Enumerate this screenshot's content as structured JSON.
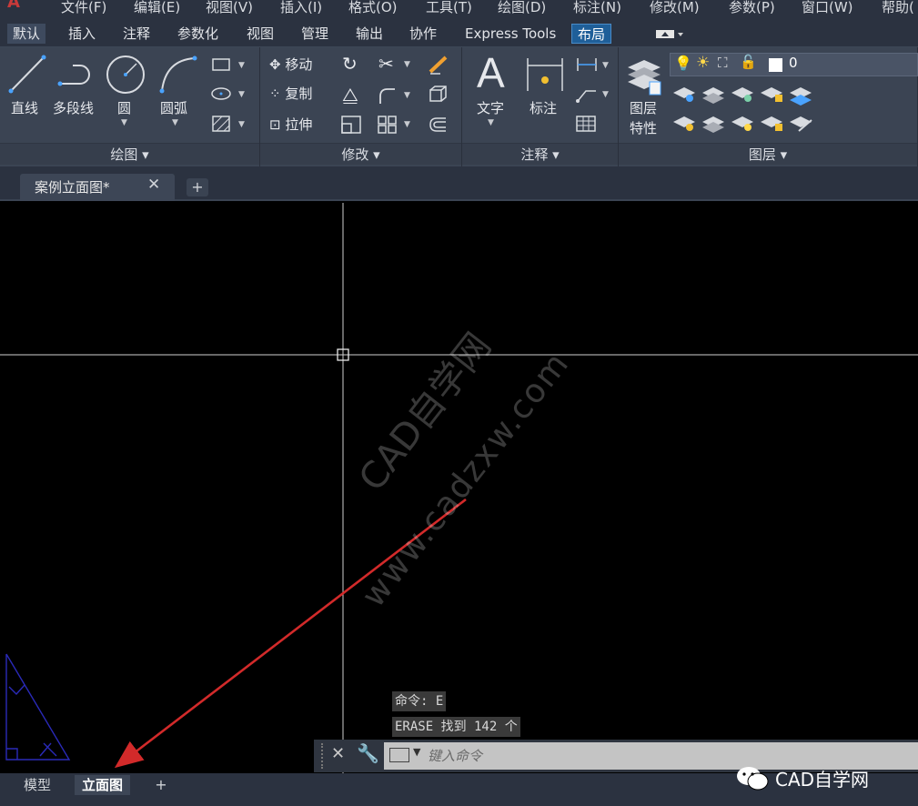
{
  "menu": {
    "items": [
      "文件(F)",
      "编辑(E)",
      "视图(V)",
      "插入(I)",
      "格式(O)",
      "工具(T)",
      "绘图(D)",
      "标注(N)",
      "修改(M)",
      "参数(P)",
      "窗口(W)",
      "帮助("
    ]
  },
  "ribbon_tabs": [
    "默认",
    "插入",
    "注释",
    "参数化",
    "视图",
    "管理",
    "输出",
    "协作",
    "Express Tools",
    "布局"
  ],
  "ribbon_active_tab": "默认",
  "panels": {
    "draw": {
      "title": "绘图",
      "tools": [
        "直线",
        "多段线",
        "圆",
        "圆弧"
      ]
    },
    "modify": {
      "title": "修改",
      "tools": [
        "移动",
        "复制",
        "拉伸"
      ]
    },
    "annotate": {
      "title": "注释",
      "tools": [
        "文字",
        "标注"
      ]
    },
    "layers": {
      "title": "图层",
      "tool_line1": "图层",
      "tool_line2": "特性",
      "current_layer": "0"
    }
  },
  "document": {
    "tab_title": "案例立面图*",
    "close_glyph": "✕",
    "new_tab_glyph": "+"
  },
  "watermark": {
    "line1": "CAD自学网",
    "line2": "www.cadzxw.com"
  },
  "command": {
    "history": [
      "命令: E",
      "ERASE 找到 142 个"
    ],
    "placeholder": "键入命令"
  },
  "layout_tabs": [
    "模型",
    "立面图"
  ],
  "layout_active": "立面图",
  "layout_add": "+",
  "brand": "CAD自学网",
  "colors": {
    "ribbon_bg": "#3b4453",
    "menubar_bg": "#2b3240",
    "highlight_tab": "#1f5f99",
    "annotation_arrow": "#d22a2a",
    "object_line": "#2a2ab8"
  }
}
